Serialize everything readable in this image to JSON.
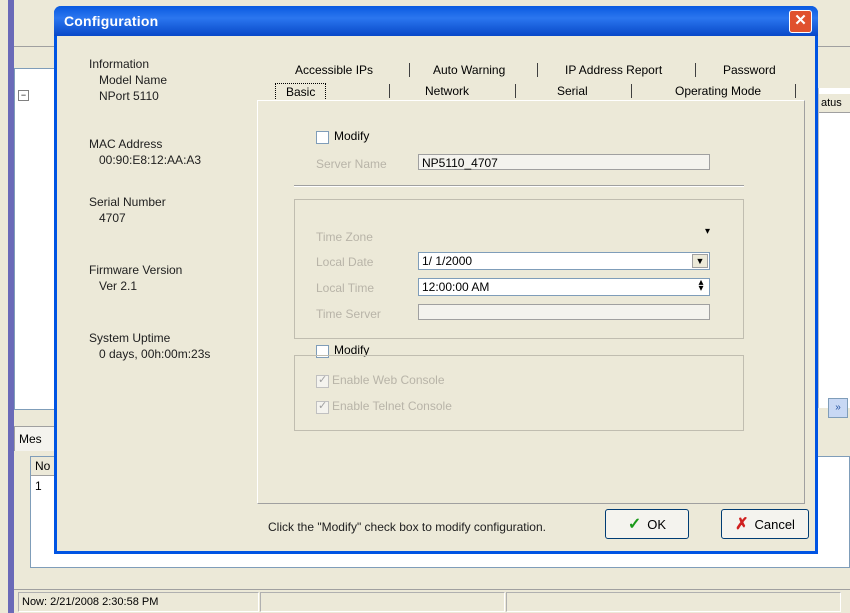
{
  "dialog": {
    "title": "Configuration",
    "close_glyph": "✕"
  },
  "info": {
    "heading": "Information",
    "model_label": "Model Name",
    "model_value": "NPort 5110",
    "mac_label": "MAC Address",
    "mac_value": "00:90:E8:12:AA:A3",
    "serial_label": "Serial Number",
    "serial_value": "4707",
    "firmware_label": "Firmware Version",
    "firmware_value": "Ver 2.1",
    "uptime_label": "System Uptime",
    "uptime_value": "0 days, 00h:00m:23s"
  },
  "tabs": {
    "row1": [
      "Accessible IPs",
      "Auto Warning",
      "IP Address Report",
      "Password"
    ],
    "row2": [
      "Basic",
      "Network",
      "Serial",
      "Operating Mode"
    ],
    "active": "Basic"
  },
  "panel": {
    "modify1_label": "Modify",
    "server_name_label": "Server Name",
    "server_name_value": "NP5110_4707",
    "time_zone_label": "Time Zone",
    "local_date_label": "Local Date",
    "local_date_value": "1/ 1/2000",
    "local_time_label": "Local Time",
    "local_time_value": "12:00:00 AM",
    "time_server_label": "Time Server",
    "time_server_value": "",
    "modify2_label": "Modify",
    "enable_web_label": "Enable Web Console",
    "enable_telnet_label": "Enable Telnet Console"
  },
  "footer": {
    "hint": "Click the \"Modify\" check box to modify configuration.",
    "ok_label": "OK",
    "ok_icon": "✓",
    "cancel_label": "Cancel",
    "cancel_icon": "✗"
  },
  "background": {
    "tree_expander": "−",
    "right_column_header": "atus",
    "scroll_glyph": "»",
    "messages_tab": "Mes",
    "list_header_no": "No",
    "list_row_1": "1",
    "status_time": "Now: 2/21/2008 2:30:58 PM"
  },
  "colors": {
    "titlebar": "#0a5ae0",
    "close": "#e0512e",
    "ok_check": "#1a9a1a",
    "cancel_x": "#d02020",
    "window_bg": "#ece9d8"
  },
  "icons": [
    "close-icon",
    "ok-check-icon",
    "cancel-x-icon",
    "dropdown-arrow-icon",
    "spin-icon"
  ]
}
